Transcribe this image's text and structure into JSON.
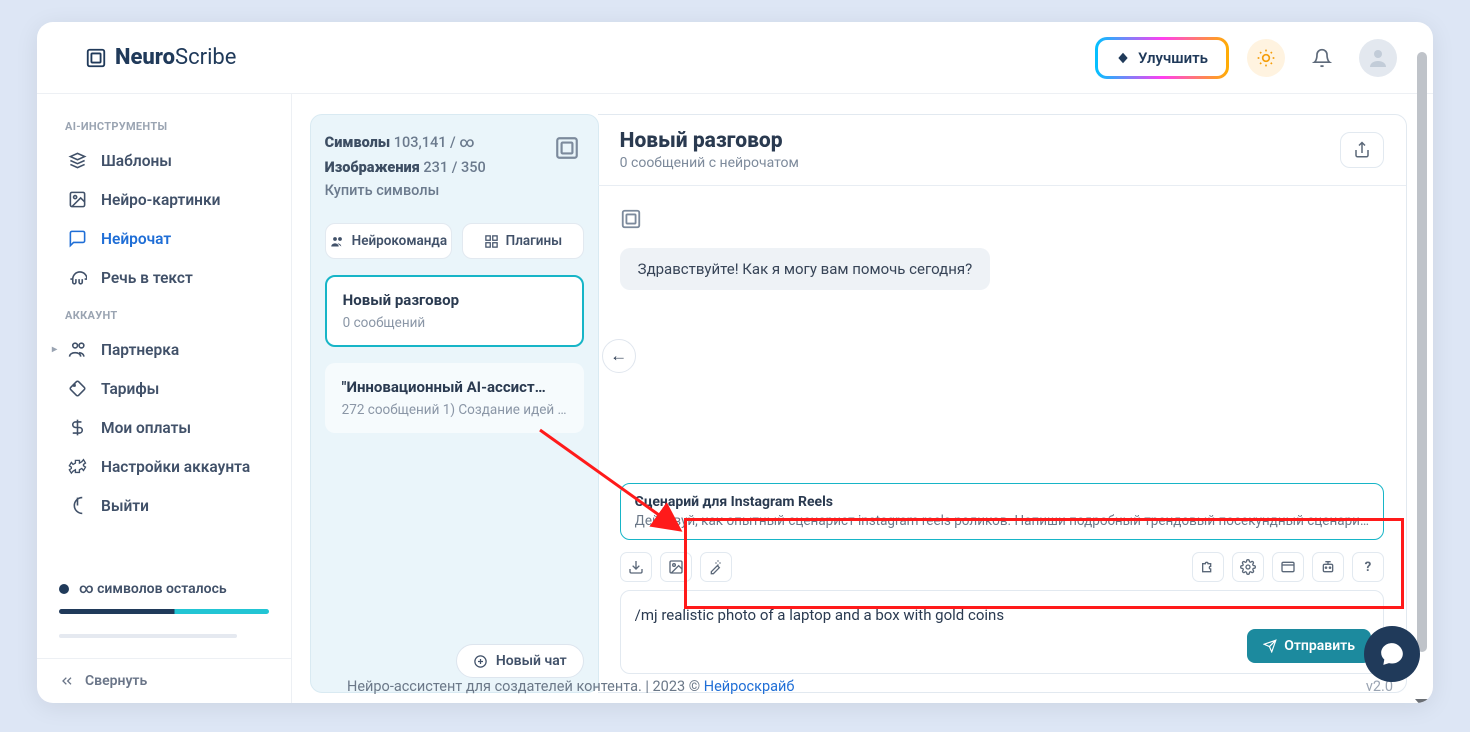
{
  "brand": {
    "neuro": "Neuro",
    "scribe": "Scribe"
  },
  "header": {
    "upgrade": "Улучшить"
  },
  "sidebar": {
    "section_tools": "AI-ИНСТРУМЕНТЫ",
    "section_account": "АККАУНТ",
    "items": {
      "templates": "Шаблоны",
      "neuro_images": "Нейро-картинки",
      "neurochat": "Нейрочат",
      "speech_to_text": "Речь в текст",
      "partner": "Партнерка",
      "tariffs": "Тарифы",
      "payments": "Мои оплаты",
      "settings": "Настройки аккаунта",
      "logout": "Выйти"
    },
    "status_text": "∞ символов осталось",
    "collapse": "Свернуть"
  },
  "left_panel": {
    "symbols_label": "Символы",
    "symbols_value": "103,141 / ∞",
    "images_label": "Изображения",
    "images_value": "231 / 350",
    "buy": "Купить символы",
    "neuroteam": "Нейрокоманда",
    "plugins": "Плагины",
    "conversations": [
      {
        "title": "Новый разговор",
        "sub": "0 сообщений"
      },
      {
        "title": "\"Инновационный AI-ассист…",
        "sub": "272 сообщений 1) Создание идей дл…"
      }
    ],
    "new_chat": "Новый чат"
  },
  "chat": {
    "title": "Новый разговор",
    "subtitle": "0 сообщений с нейрочатом",
    "greeting": "Здравствуйте! Как я могу вам помочь сегодня?",
    "scenario_title": "Сценарий для Instagram Reels",
    "scenario_text": "Действуй, как опытный сценарист instagram reels роликов. Напиши подробный трендовый посекундный сценари…",
    "input_value": "/mj realistic photo of a laptop and a box with gold coins",
    "send": "Отправить"
  },
  "footer": {
    "text": "Нейро-ассистент для создателей контента.  | 2023 © ",
    "link": "Нейроскрайб",
    "version": "v2.0"
  }
}
